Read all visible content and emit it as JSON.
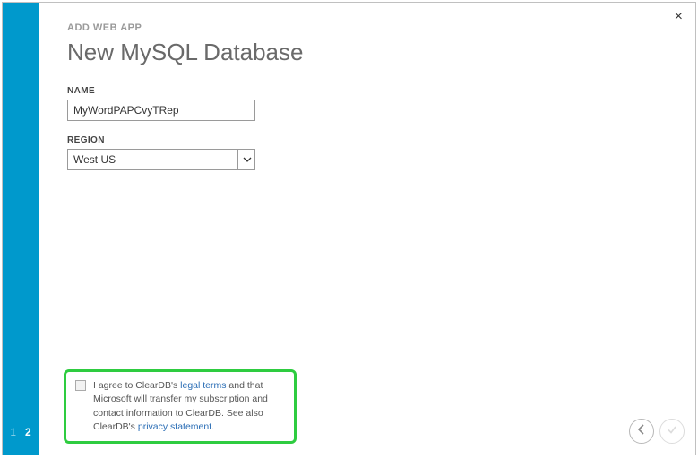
{
  "breadcrumb": "ADD WEB APP",
  "title": "New MySQL Database",
  "steps": {
    "items": [
      "1",
      "2"
    ],
    "current": 1
  },
  "name_field": {
    "label": "NAME",
    "value": "MyWordPAPCvyTRep"
  },
  "region_field": {
    "label": "REGION",
    "value": "West US"
  },
  "consent": {
    "prefix": "I agree to ClearDB's ",
    "legal_link": "legal terms",
    "middle": " and that Microsoft will transfer my subscription and contact information to ClearDB. See also ClearDB's ",
    "privacy_link": "privacy statement",
    "suffix": "."
  },
  "close_label": "×"
}
